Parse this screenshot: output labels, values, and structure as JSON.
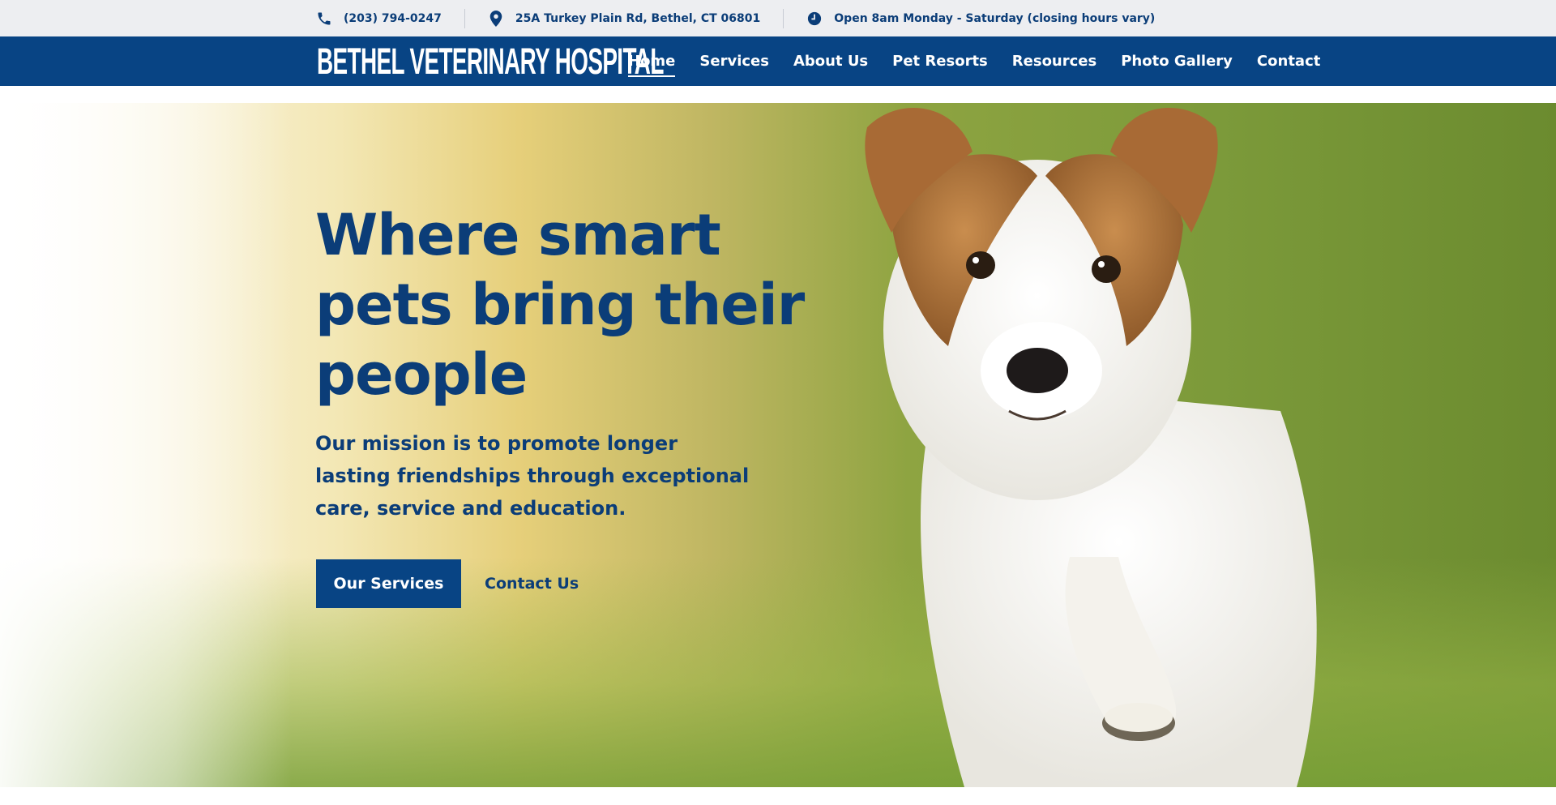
{
  "topbar": {
    "phone": {
      "icon": "phone-icon",
      "text": "(203) 794-0247"
    },
    "address": {
      "icon": "map-pin-icon",
      "text": "25A Turkey Plain Rd, Bethel, CT 06801"
    },
    "hours": {
      "icon": "clock-icon",
      "text": "Open 8am Monday - Saturday (closing hours vary)"
    }
  },
  "header": {
    "logo_text": "BETHEL VETERINARY HOSPITAL",
    "nav": [
      {
        "label": "Home",
        "active": true
      },
      {
        "label": "Services",
        "active": false
      },
      {
        "label": "About Us",
        "active": false
      },
      {
        "label": "Pet Resorts",
        "active": false
      },
      {
        "label": "Resources",
        "active": false
      },
      {
        "label": "Photo Gallery",
        "active": false
      },
      {
        "label": "Contact",
        "active": false
      }
    ]
  },
  "hero": {
    "title_lines": [
      "Where smart",
      "pets bring their",
      "people"
    ],
    "subtitle_lines": [
      "Our mission is to promote longer",
      "lasting friendships through exceptional",
      "care, service and education."
    ],
    "primary_button": "Our Services",
    "secondary_link": "Contact Us",
    "image": "dog-photo"
  },
  "colors": {
    "brand_blue": "#084484",
    "text_blue": "#0b3d78",
    "topbar_bg": "#edeef1"
  }
}
